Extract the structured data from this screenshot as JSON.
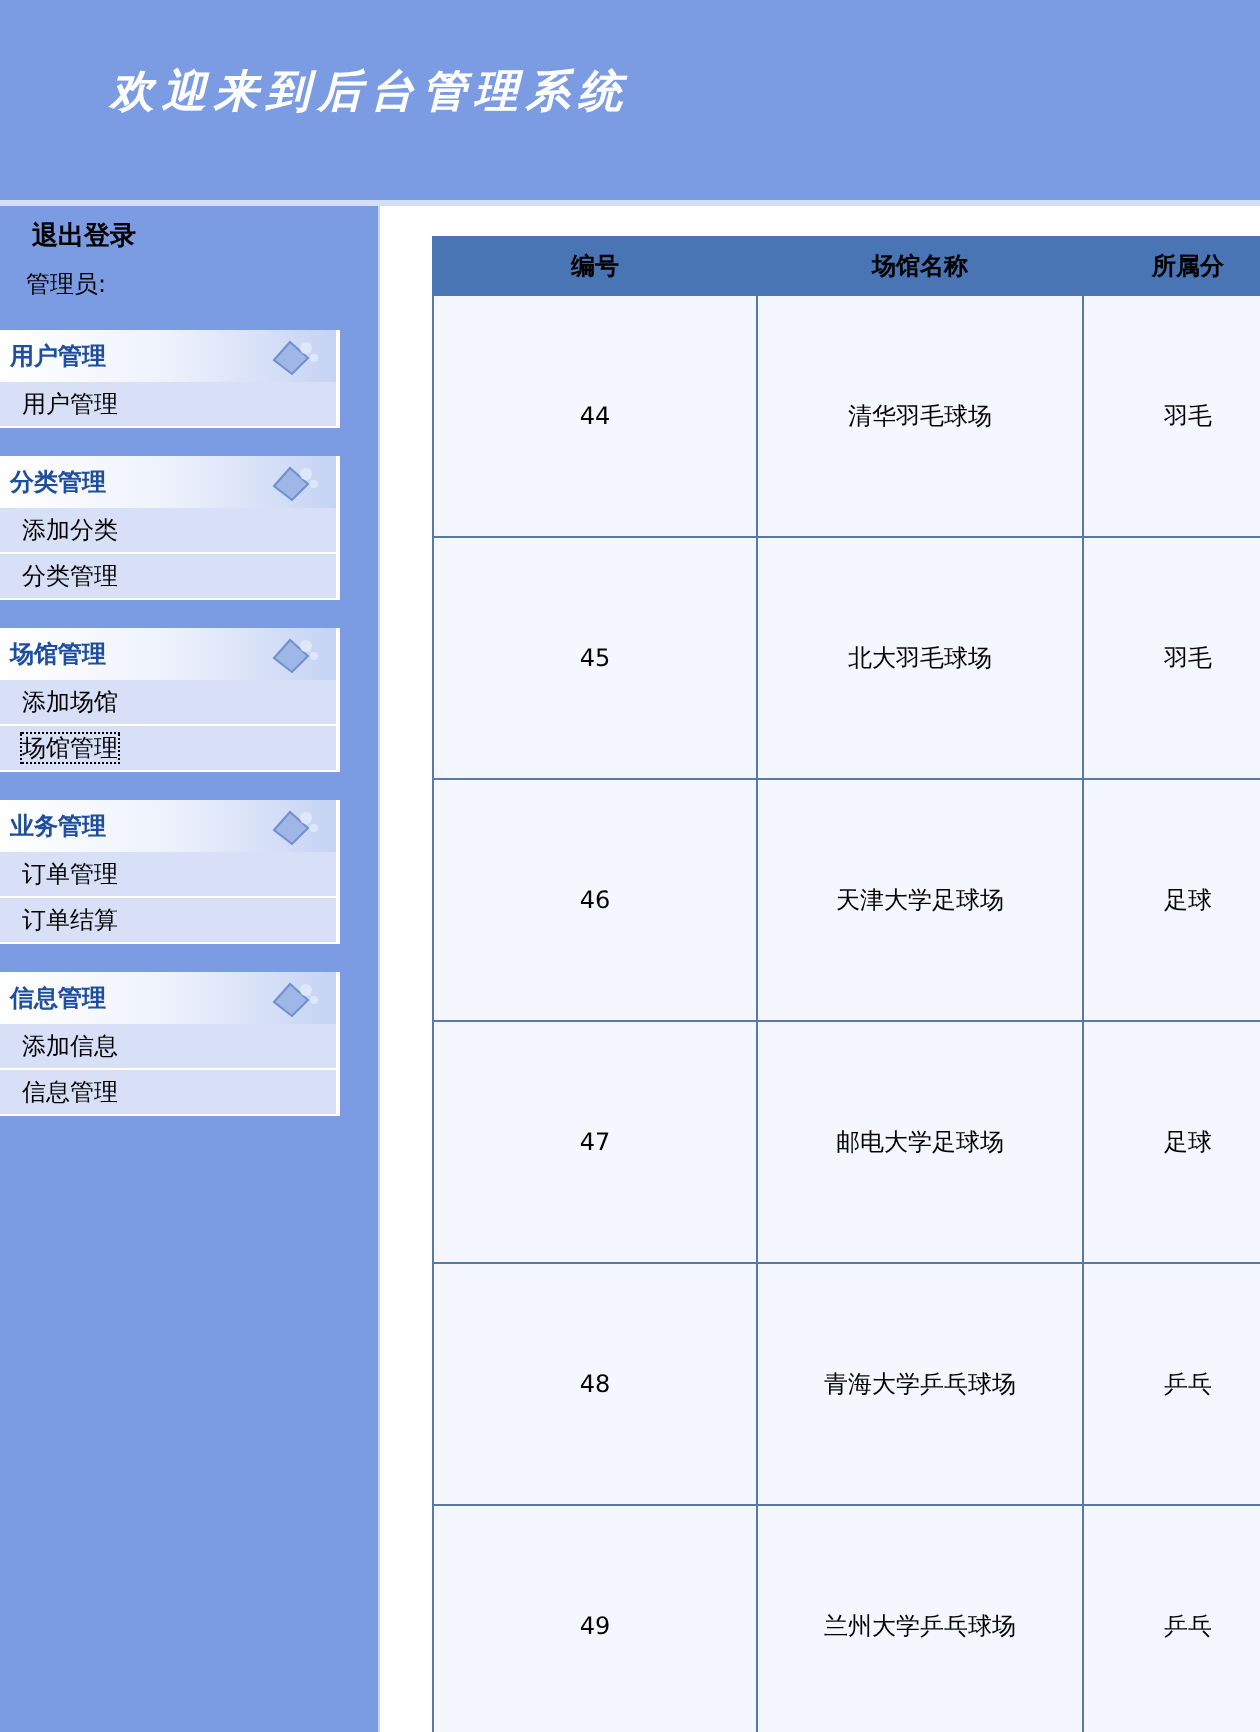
{
  "header": {
    "title": "欢迎来到后台管理系统"
  },
  "sidebar": {
    "logout": "退出登录",
    "user_label": "管理员:",
    "groups": [
      {
        "title": "用户管理",
        "items": [
          {
            "label": "用户管理",
            "selected": false
          }
        ]
      },
      {
        "title": "分类管理",
        "items": [
          {
            "label": "添加分类",
            "selected": false
          },
          {
            "label": "分类管理",
            "selected": false
          }
        ]
      },
      {
        "title": "场馆管理",
        "items": [
          {
            "label": "添加场馆",
            "selected": false
          },
          {
            "label": "场馆管理",
            "selected": true
          }
        ]
      },
      {
        "title": "业务管理",
        "items": [
          {
            "label": "订单管理",
            "selected": false
          },
          {
            "label": "订单结算",
            "selected": false
          }
        ]
      },
      {
        "title": "信息管理",
        "items": [
          {
            "label": "添加信息",
            "selected": false
          },
          {
            "label": "信息管理",
            "selected": false
          }
        ]
      }
    ]
  },
  "table": {
    "columns": [
      "编号",
      "场馆名称",
      "所属分"
    ],
    "rows": [
      [
        "44",
        "清华羽毛球场",
        "羽毛"
      ],
      [
        "45",
        "北大羽毛球场",
        "羽毛"
      ],
      [
        "46",
        "天津大学足球场",
        "足球"
      ],
      [
        "47",
        "邮电大学足球场",
        "足球"
      ],
      [
        "48",
        "青海大学乒乓球场",
        "乒乓"
      ],
      [
        "49",
        "兰州大学乒乓球场",
        "乒乓"
      ]
    ]
  }
}
